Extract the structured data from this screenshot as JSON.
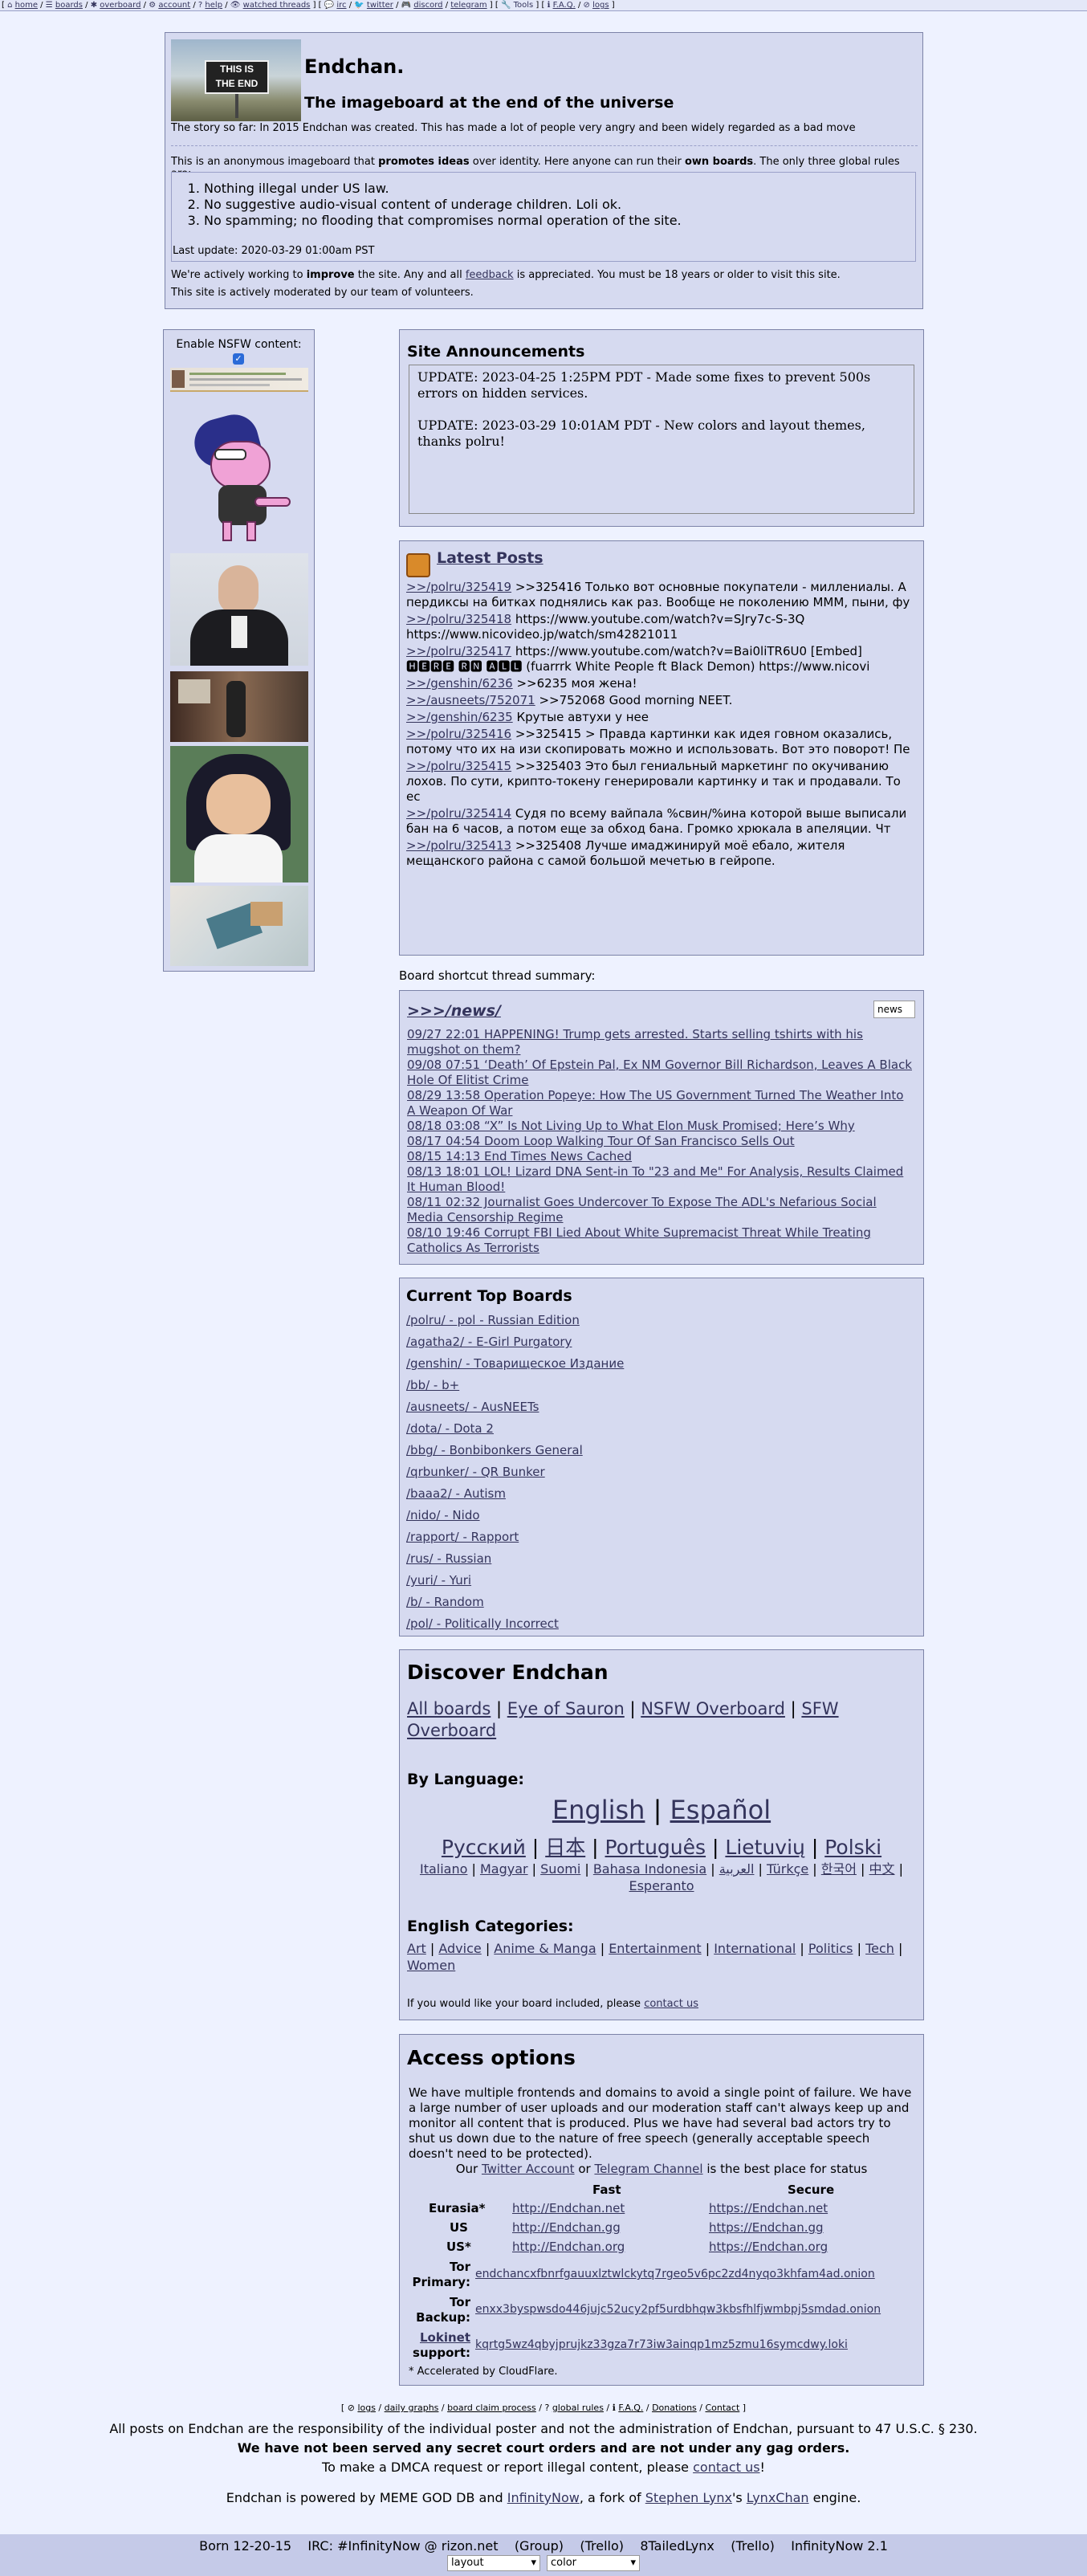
{
  "nav": {
    "items": [
      "home",
      "boards",
      "overboard",
      "account",
      "help",
      "watched threads",
      "irc",
      "twitter",
      "discord",
      "telegram",
      "Tools",
      "F.A.Q.",
      "logs"
    ]
  },
  "header": {
    "logo_line1": "THIS IS",
    "logo_line2": "THE END",
    "title": "Endchan.",
    "subtitle": "The imageboard at the end of the universe",
    "story": "The story so far: In 2015 Endchan was created. This has made a lot of people very angry and been widely regarded as a bad move",
    "intro_a": "This is an anonymous imageboard that ",
    "intro_b": "promotes ideas",
    "intro_c": " over identity. Here anyone can run their ",
    "intro_d": "own boards",
    "intro_e": ". The only three global rules are:",
    "rules": [
      "Nothing illegal under US law.",
      "No suggestive audio-visual content of underage children. Loli ok.",
      "No spamming; no flooding that compromises normal operation of the site."
    ],
    "last_update": "Last update: 2020-03-29 01:00am PST",
    "improve_a": "We're actively working to ",
    "improve_b": "improve",
    "improve_c": " the site. Any and all ",
    "feedback": "feedback",
    "improve_d": " is appreciated. You must be 18 years or older to visit this site.",
    "moderated": "This site is actively moderated by our team of volunteers."
  },
  "nsfw": {
    "label": "Enable NSFW content:"
  },
  "announcements": {
    "title": "Site Announcements",
    "items": [
      "UPDATE: 2023-04-25 1:25PM PDT - Made some fixes to prevent 500s errors on hidden services.",
      "UPDATE: 2023-03-29 10:01AM PDT - New colors and layout themes, thanks polru!"
    ]
  },
  "latest": {
    "title": "Latest Posts",
    "posts": [
      {
        "link": ">>/polru/325419",
        "text": " >>325416 Только вот основные покупатели - миллениалы. А пердиксы на битках поднялись как раз. Вообще не поколению МММ, пыни, фу"
      },
      {
        "link": ">>/polru/325418",
        "text": " https://www.youtube.com/watch?v=SJry7c-S-3Q https://www.nicovideo.jp/watch/sm42821011"
      },
      {
        "link": ">>/polru/325417",
        "text": " https://www.youtube.com/watch?v=Bai0liTR6U0 [Embed] 🅷🅴🆁🅴 🆁🅽 🅰🅻🅻 (fuarrrk White People ft Black Demon) https://www.nicovi"
      },
      {
        "link": ">>/genshin/6236",
        "text": " >>6235 моя жена!"
      },
      {
        "link": ">>/ausneets/752071",
        "text": " >>752068 Good morning NEET."
      },
      {
        "link": ">>/genshin/6235",
        "text": " Крутые автухи у нее"
      },
      {
        "link": ">>/polru/325416",
        "text": " >>325415 > Правда картинки как идея говном оказались, потому что их на изи скопировать можно и использовать. Вот это поворот! Пе"
      },
      {
        "link": ">>/polru/325415",
        "text": " >>325403 Это был гениальный маркетинг по окучиванию лохов. По сути, крипто-токену генерировали картинку и так и продавали. То ес"
      },
      {
        "link": ">>/polru/325414",
        "text": " Судя по всему вайпала %свин/%ина которой выше выписали бан на 6 часов, а потом еще за обход бана. Громко хрюкала в апеляции. Чт"
      },
      {
        "link": ">>/polru/325413",
        "text": " >>325408 Лучше имаджинируй моё ебало, жителя мещанского района с самой большой мечетью в гейропе."
      }
    ]
  },
  "summary": {
    "label": "Board shortcut thread summary:",
    "board": ">>>/news/",
    "select_value": "news",
    "threads": [
      "09/27 22:01 HAPPENING! Trump gets arrested. Starts selling tshirts with his mugshot on them?",
      "09/08 07:51 ‘Death’ Of Epstein Pal, Ex NM Governor Bill Richardson, Leaves A Black Hole Of Elitist Crime",
      "08/29 13:58 Operation Popeye: How The US Government Turned The Weather Into A Weapon Of War",
      "08/18 03:08 “X” Is Not Living Up to What Elon Musk Promised; Here’s Why",
      "08/17 04:54 Doom Loop Walking Tour Of San Francisco Sells Out",
      "08/15 14:13 End Times News Cached",
      "08/13 18:01 LOL! Lizard DNA Sent-in To \"23 and Me\" For Analysis, Results Claimed It Human Blood!",
      "08/11 02:32 Journalist Goes Undercover To Expose The ADL's Nefarious Social Media Censorship Regime",
      "08/10 19:46 Corrupt FBI Lied About White Supremacist Threat While Treating Catholics As Terrorists"
    ]
  },
  "top_boards": {
    "title": "Current Top Boards",
    "boards": [
      "/polru/ - pol - Russian Edition",
      "/agatha2/ - E-Girl Purgatory",
      "/genshin/ - Товарищеское Издание",
      "/bb/ - b+",
      "/ausneets/ - AusNEETs",
      "/dota/ - Dota 2",
      "/bbg/ - Bonbibonkers General",
      "/qrbunker/ - QR Bunker",
      "/baaa2/ - Autism",
      "/nido/ - Nido",
      "/rapport/ - Rapport",
      "/rus/ - Russian",
      "/yuri/ - Yuri",
      "/b/ - Random",
      "/pol/ - Politically Incorrect"
    ]
  },
  "discover": {
    "title": "Discover Endchan",
    "links": [
      "All boards",
      "Eye of Sauron",
      "NSFW Overboard",
      "SFW Overboard"
    ],
    "by_language": "By Language:",
    "lang_big": [
      "English",
      "Español"
    ],
    "lang_mid": [
      "Русский",
      "日本",
      "Português",
      "Lietuvių",
      "Polski"
    ],
    "lang_small": [
      "Italiano",
      "Magyar",
      "Suomi",
      "Bahasa Indonesia",
      "العربية",
      "Türkçe",
      "한국어",
      "中文",
      "Esperanto"
    ],
    "categories_title": "English Categories:",
    "categories": [
      "Art",
      "Advice",
      "Anime & Manga",
      "Entertainment",
      "International",
      "Politics",
      "Tech",
      "Women"
    ],
    "include_a": "If you would like your board included, please ",
    "include_link": "contact us"
  },
  "access": {
    "title": "Access options",
    "desc": "We have multiple frontends and domains to avoid a single point of failure. We have a large number of user uploads and our moderation staff can't always keep up and monitor all content that is produced. Plus we have had several bad actors try to shut us down due to the nature of free speech (generally acceptable speech doesn't need to be protected).",
    "status_a": "Our ",
    "twitter": "Twitter Account",
    "status_b": " or ",
    "telegram": "Telegram Channel",
    "status_c": " is the best place for status",
    "col_fast": "Fast",
    "col_secure": "Secure",
    "rows": [
      {
        "label": "Eurasia*",
        "fast": "http://Endchan.net",
        "secure": "https://Endchan.net"
      },
      {
        "label": "US",
        "fast": "http://Endchan.gg",
        "secure": "https://Endchan.gg"
      },
      {
        "label": "US*",
        "fast": "http://Endchan.org",
        "secure": "https://Endchan.org"
      }
    ],
    "tor_primary_label": "Tor Primary:",
    "tor_primary": "endchancxfbnrfgauuxlztwlckytq7rgeo5v6pc2zd4nyqo3khfam4ad.onion",
    "tor_backup_label": "Tor Backup:",
    "tor_backup": "enxx3byspwsdo446jujc52ucy2pf5urdbhqw3kbsfhlfjwmbpj5smdad.onion",
    "lokinet_label": "Lokinet",
    "lokinet_suffix": " support:",
    "lokinet": "kqrtg5wz4qbyjprujkz33gza7r73iw3ainqp1mz5zmu16symcdwy.loki",
    "cf_note": "* Accelerated by CloudFlare."
  },
  "footer": {
    "links": [
      "logs",
      "daily graphs",
      "board claim process",
      "global rules",
      "F.A.Q.",
      "Donations",
      "Contact"
    ],
    "responsibility": "All posts on Endchan are the responsibility of the individual poster and not the administration of Endchan, pursuant to 47 U.S.C. § 230.",
    "no_orders": "We have not been served any secret court orders and are not under any gag orders.",
    "dmca_a": "To make a DMCA request or report illegal content, please ",
    "dmca_link": "contact us",
    "dmca_b": "!",
    "powered_a": "Endchan is powered by MEME GOD DB and ",
    "infinitynow": "InfinityNow",
    "powered_b": ", a fork of ",
    "stephen": "Stephen Lynx",
    "powered_c": "'s ",
    "lynxchan": "LynxChan",
    "powered_d": " engine.",
    "bar_born": "Born 12-20-15",
    "bar_irc": "IRC: #InfinityNow @ rizon.net",
    "bar_group": "(Group)",
    "bar_trello1": "(Trello)",
    "bar_8tl": "8TailedLynx",
    "bar_trello2": "(Trello)",
    "bar_version": "InfinityNow 2.1",
    "layout_value": "layout",
    "color_value": "color"
  }
}
